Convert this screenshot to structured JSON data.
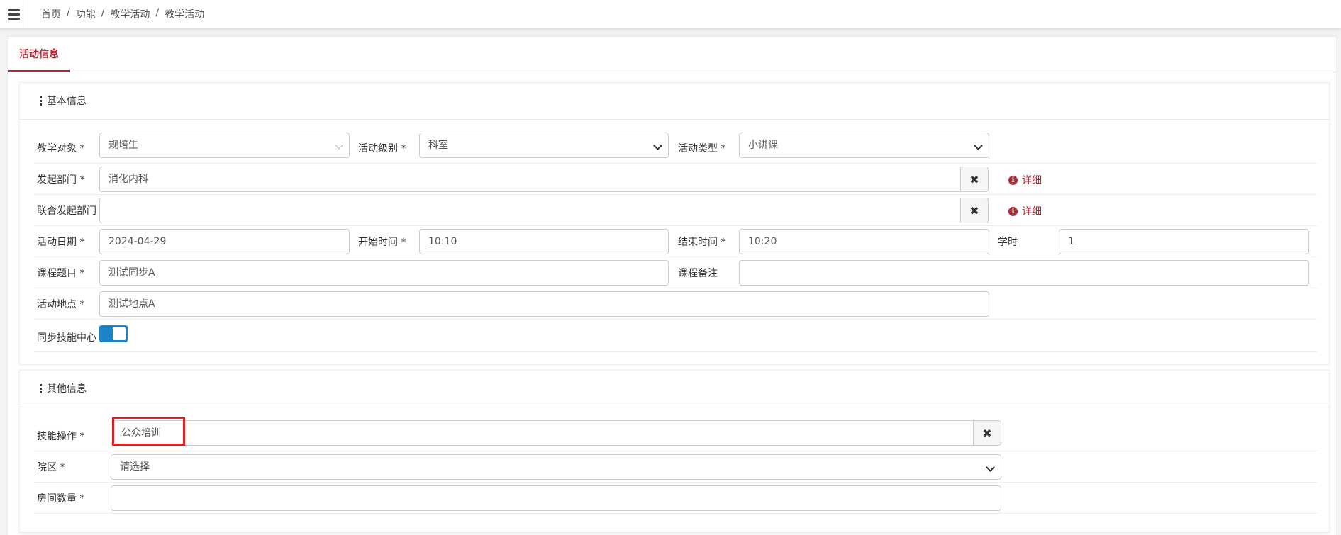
{
  "breadcrumb": [
    "首页",
    "功能",
    "教学活动",
    "教学活动"
  ],
  "tab": "活动信息",
  "basic": {
    "title": "基本信息",
    "teach_target_label": "教学对象 *",
    "teach_target_value": "规培生",
    "activity_level_label": "活动级别 *",
    "activity_level_value": "科室",
    "activity_type_label": "活动类型 *",
    "activity_type_value": "小讲课",
    "dept_label": "发起部门 *",
    "dept_value": "消化内科",
    "joint_dept_label": "联合发起部门",
    "joint_dept_value": "",
    "detail_label": "详细",
    "date_label": "活动日期 *",
    "date_value": "2024-04-29",
    "start_label": "开始时间 *",
    "start_value": "10:10",
    "end_label": "结束时间 *",
    "end_value": "10:20",
    "hours_label": "学时",
    "hours_value": "1",
    "course_title_label": "课程题目 *",
    "course_title_value": "测试同步A",
    "course_note_label": "课程备注",
    "course_note_value": "",
    "location_label": "活动地点 *",
    "location_value": "测试地点A",
    "sync_label": "同步技能中心",
    "sync_on": true
  },
  "other": {
    "title": "其他信息",
    "skill_label": "技能操作 *",
    "skill_value": "公众培训",
    "campus_label": "院区 *",
    "campus_value": "请选择",
    "rooms_label": "房间数量 *",
    "rooms_value": ""
  },
  "clear_symbol": "✖",
  "info_symbol": "i"
}
